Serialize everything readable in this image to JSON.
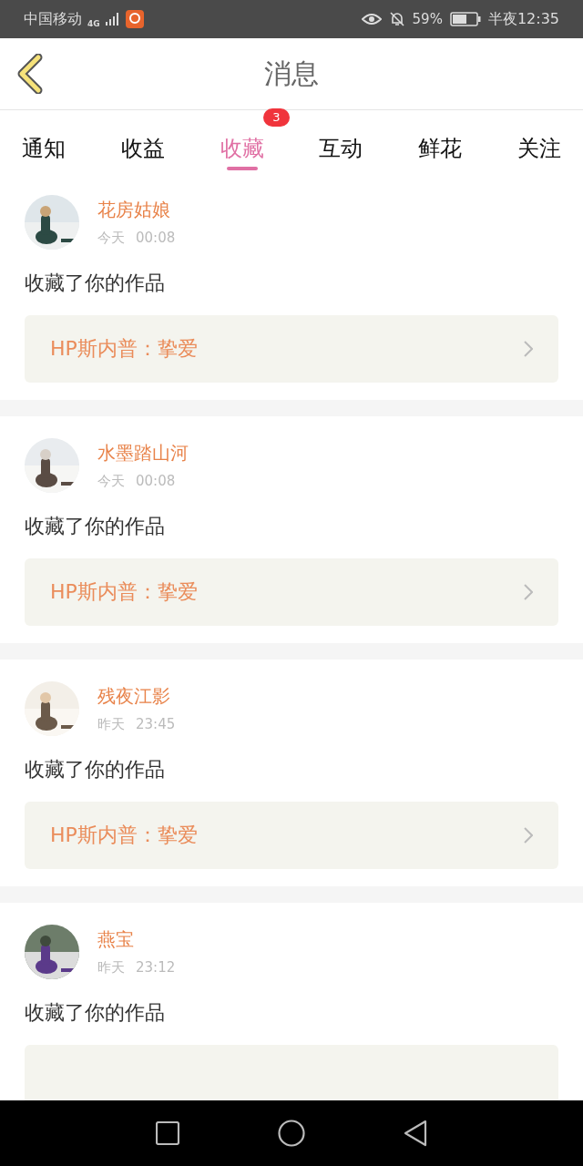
{
  "status_bar": {
    "carrier": "中国移动",
    "network": "4G",
    "battery_percent": "59%",
    "time": "半夜12:35"
  },
  "header": {
    "title": "消息"
  },
  "tabs": [
    {
      "label": "通知",
      "selected": false
    },
    {
      "label": "收益",
      "selected": false
    },
    {
      "label": "收藏",
      "selected": true,
      "badge": "3"
    },
    {
      "label": "互动",
      "selected": false
    },
    {
      "label": "鲜花",
      "selected": false
    },
    {
      "label": "关注",
      "selected": false
    }
  ],
  "messages": [
    {
      "name": "花房姑娘",
      "day": "今天",
      "time": "00:08",
      "action": "收藏了你的作品",
      "work": "HP斯内普：挚爱"
    },
    {
      "name": "水墨踏山河",
      "day": "今天",
      "time": "00:08",
      "action": "收藏了你的作品",
      "work": "HP斯内普：挚爱"
    },
    {
      "name": "残夜江影",
      "day": "昨天",
      "time": "23:45",
      "action": "收藏了你的作品",
      "work": "HP斯内普：挚爱"
    },
    {
      "name": "燕宝",
      "day": "昨天",
      "time": "23:12",
      "action": "收藏了你的作品"
    }
  ]
}
